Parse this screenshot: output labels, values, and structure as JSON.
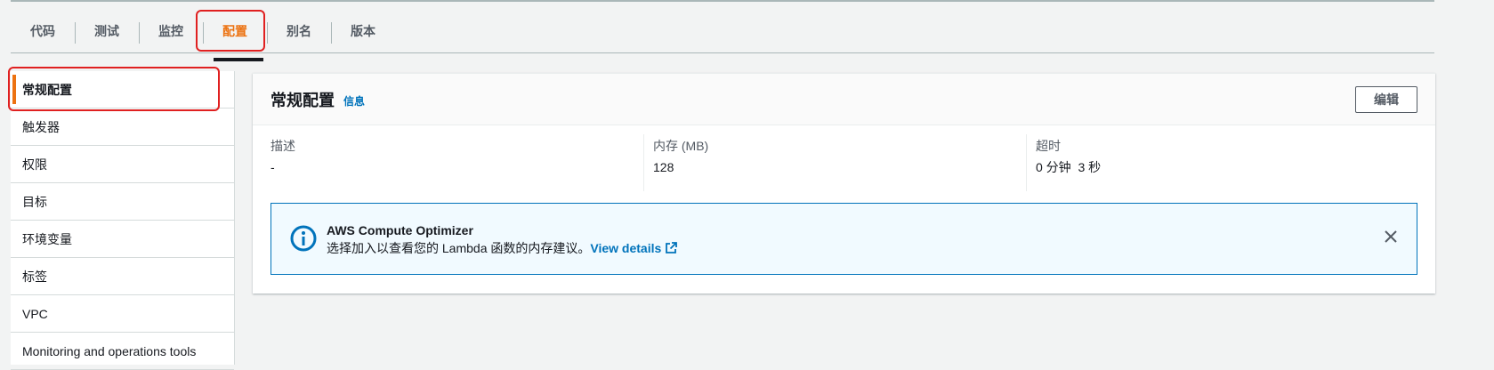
{
  "tabs": [
    {
      "label": "代码"
    },
    {
      "label": "测试"
    },
    {
      "label": "监控"
    },
    {
      "label": "配置"
    },
    {
      "label": "别名"
    },
    {
      "label": "版本"
    }
  ],
  "active_tab": "配置",
  "sidebar": {
    "items": [
      {
        "label": "常规配置"
      },
      {
        "label": "触发器"
      },
      {
        "label": "权限"
      },
      {
        "label": "目标"
      },
      {
        "label": "环境变量"
      },
      {
        "label": "标签"
      },
      {
        "label": "VPC"
      },
      {
        "label": "Monitoring and operations tools"
      }
    ]
  },
  "panel": {
    "title": "常规配置",
    "info_link": "信息",
    "edit_label": "编辑",
    "fields": [
      {
        "label": "描述",
        "value": "-"
      },
      {
        "label": "内存 (MB)",
        "value": "128"
      },
      {
        "label": "超时",
        "value": "0 分钟  3 秒"
      }
    ]
  },
  "alert": {
    "title": "AWS Compute Optimizer",
    "text": "选择加入以查看您的 Lambda 函数的内存建议。",
    "link": "View details"
  },
  "colors": {
    "accent": "#ec7211",
    "link": "#0073bb",
    "highlight_box": "#e02020",
    "info_bg": "#f1faff"
  },
  "icons": [
    "info-icon",
    "external-link-icon",
    "close-icon"
  ]
}
